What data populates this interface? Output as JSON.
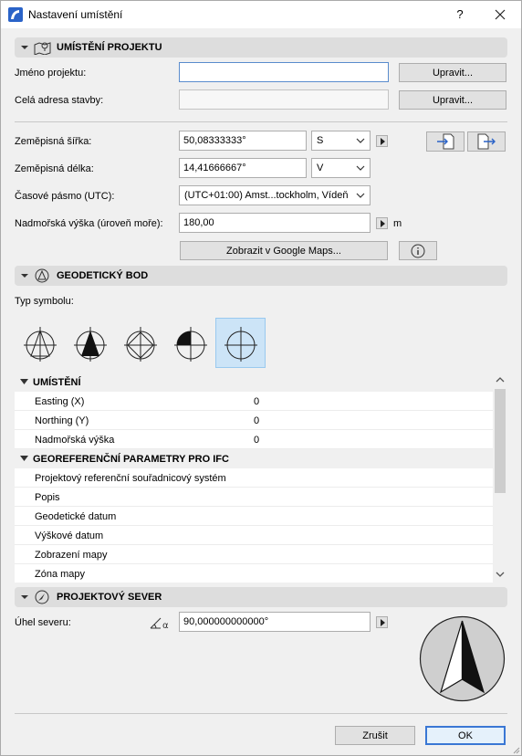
{
  "window": {
    "title": "Nastavení umístění",
    "help": "?",
    "close": "✕"
  },
  "project_section": {
    "title": "UMÍSTĚNÍ PROJEKTU",
    "project_name_label": "Jméno projektu:",
    "project_name_value": "",
    "address_label": "Celá adresa stavby:",
    "address_value": "",
    "edit_label": "Upravit...",
    "latitude_label": "Zeměpisná šířka:",
    "latitude_value": "50,08333333°",
    "latitude_dir": "S",
    "longitude_label": "Zeměpisná délka:",
    "longitude_value": "14,41666667°",
    "longitude_dir": "V",
    "timezone_label": "Časové pásmo (UTC):",
    "timezone_value": "(UTC+01:00) Amst...tockholm, Vídeň",
    "altitude_label": "Nadmořská výška (úroveň moře):",
    "altitude_value": "180,00",
    "altitude_unit": "m",
    "google_maps_label": "Zobrazit v Google Maps..."
  },
  "survey_section": {
    "title": "GEODETICKÝ BOD",
    "symbol_type_label": "Typ symbolu:",
    "selected_symbol": 5
  },
  "grid": {
    "group1": "UMÍSTĚNÍ",
    "rows1": [
      {
        "name": "Easting (X)",
        "value": "0"
      },
      {
        "name": "Northing (Y)",
        "value": "0"
      },
      {
        "name": "Nadmořská výška",
        "value": "0"
      }
    ],
    "group2": "GEOREFERENČNÍ PARAMETRY PRO IFC",
    "rows2": [
      {
        "name": "Projektový referenční souřadnicový systém"
      },
      {
        "name": "Popis"
      },
      {
        "name": "Geodetické datum"
      },
      {
        "name": "Výškové datum"
      },
      {
        "name": "Zobrazení mapy"
      },
      {
        "name": "Zóna mapy"
      }
    ]
  },
  "north_section": {
    "title": "PROJEKTOVÝ SEVER",
    "angle_label": "Úhel severu:",
    "angle_value": "90,000000000000°"
  },
  "footer": {
    "cancel_label": "Zrušit",
    "ok_label": "OK"
  },
  "colors": {
    "accent": "#3a77d4",
    "section_bg": "#dddddd",
    "selection": "#cce4f7"
  }
}
